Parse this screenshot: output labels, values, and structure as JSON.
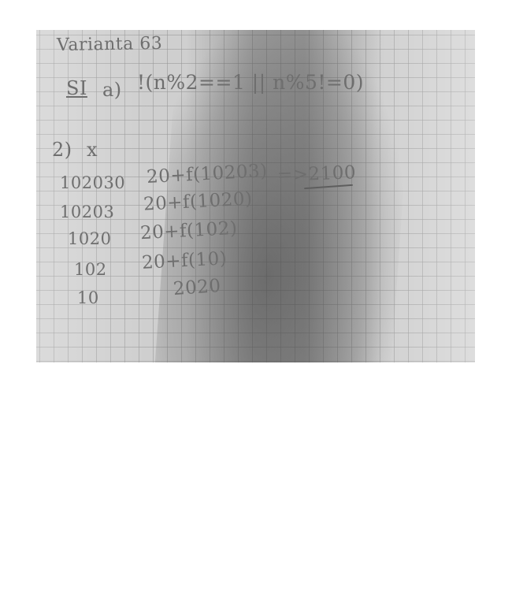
{
  "notebook": {
    "title": "Varianta 63",
    "line_s1_label": "SI",
    "line_s1_item": "a)",
    "line_s1_expr": "!(n%2==1 || n%5!=0)",
    "section2_label": "2)",
    "column_header_x": "x",
    "x_values": [
      "102030",
      "10203",
      "1020",
      "102",
      "10"
    ],
    "calls": [
      "20+f(10203)",
      "20+f(1020)",
      "20+f(102)",
      "20+f(10)",
      "2020"
    ],
    "result": "=>2100"
  }
}
